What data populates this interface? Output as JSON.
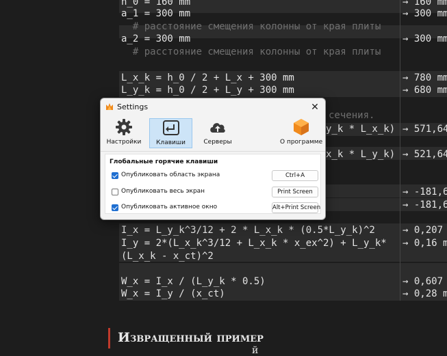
{
  "document": {
    "lines": [
      {
        "text": "h_0 = 160 mm",
        "result": "→ 160 mm",
        "comment": false
      },
      {
        "text": "a_1 = 300 mm",
        "result": "→ 300 mm",
        "comment": false
      },
      {
        "text": "  # расстояние смещения колонны от края плиты",
        "result": "",
        "comment": true
      },
      {
        "text": "a_2 = 300 mm",
        "result": "→ 300 mm",
        "comment": false
      },
      {
        "text": "  # расстояние смещения колонны от края плиты",
        "result": "",
        "comment": true
      },
      {
        "text": "L_x_k = h_0 / 2 + L_x + 300 mm",
        "result": "→ 780 mm",
        "comment": false
      },
      {
        "text": "L_y_k = h_0 / 2 + L_y + 300 mm",
        "result": "→ 680 mm",
        "comment": false
      },
      {
        "text": "сечения.",
        "result": "",
        "comment": true
      },
      {
        "text": "y_k * L_x_k)",
        "result": "→ 571,64",
        "comment": false
      },
      {
        "text": "x_k * L_y_k)",
        "result": "→ 521,64",
        "comment": false
      },
      {
        "text": "",
        "result": "→ -181,6",
        "comment": false
      },
      {
        "text": "",
        "result": "→ -181,6",
        "comment": false
      },
      {
        "text": "I_x = L_y_k^3/12 + 2 * L_x_k * (0.5*L_y_k)^2",
        "result": "→ 0,207",
        "comment": false
      },
      {
        "text": "I_y = 2*(L_x_k^3/12 + L_x_k * x_ex^2) + L_y_k*",
        "result": "→ 0,16 m",
        "comment": false
      },
      {
        "text": "(L_x_k - x_ct)^2",
        "result": "",
        "comment": false
      },
      {
        "text": "W_x = I_x / (L_y_k * 0.5)",
        "result": "→ 0,607",
        "comment": false
      },
      {
        "text": "W_x = I_y / (x_ct)",
        "result": "→ 0,28 m",
        "comment": false
      }
    ],
    "heading": "Извращенный пример",
    "cut_text": "й"
  },
  "dialog": {
    "title": "Settings",
    "close_glyph": "✕",
    "toolbar": [
      {
        "label": "Настройки",
        "icon": "gear-icon",
        "active": false
      },
      {
        "label": "Клавиши",
        "icon": "keyboard-enter-icon",
        "active": true
      },
      {
        "label": "Серверы",
        "icon": "cloud-upload-icon",
        "active": false
      },
      {
        "label": "О программе",
        "icon": "app-logo-icon",
        "active": false
      }
    ],
    "section_title": "Глобальные горячие клавиши",
    "rows": [
      {
        "label": "Опубликовать область экрана",
        "checked": true,
        "hotkey": "Ctrl+A"
      },
      {
        "label": "Опубликовать весь экран",
        "checked": false,
        "hotkey": "Print Screen"
      },
      {
        "label": "Опубликовать активное окно",
        "checked": true,
        "hotkey": "Alt+Print Screen"
      }
    ],
    "accent_color": "#1f6fd1",
    "active_tab_color": "#cde4f7",
    "logo_color": "#f08a1c"
  }
}
